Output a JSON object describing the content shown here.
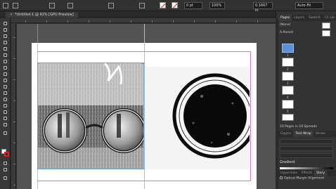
{
  "control_bar": {
    "stroke_weight": "0 pt",
    "width_value": "0.1667 in",
    "percent": "100%",
    "auto_fit": "Auto-Fit"
  },
  "document": {
    "tab_title": "*Untitled-1 @ 41% [GPU Preview]"
  },
  "pages_panel": {
    "tabs": [
      "Pages",
      "Layers",
      "Swatch",
      "CC Lib"
    ],
    "active_tab": "Pages",
    "masters": [
      "[None]",
      "A-Parent"
    ],
    "page_numbers": [
      "1",
      "2",
      "3",
      "4",
      "5",
      "6",
      "7"
    ],
    "summary": "10 Pages in 10 Spreads"
  },
  "wrap_panel": {
    "tabs": [
      "Glyphs",
      "Text Wrap",
      "Stroke"
    ],
    "active_tab": "Text Wrap"
  },
  "gradient_panel": {
    "heading": "Gradient"
  },
  "bottom_panel": {
    "tabs": [
      "Hyperlinks",
      "Effects",
      "Story"
    ],
    "active_tab": "Story",
    "option_label": "Optical Margin Alignment"
  },
  "colors": {
    "accent": "#5b8fd6",
    "guide": "#7fd0e6",
    "margin": "#c77bc7"
  }
}
